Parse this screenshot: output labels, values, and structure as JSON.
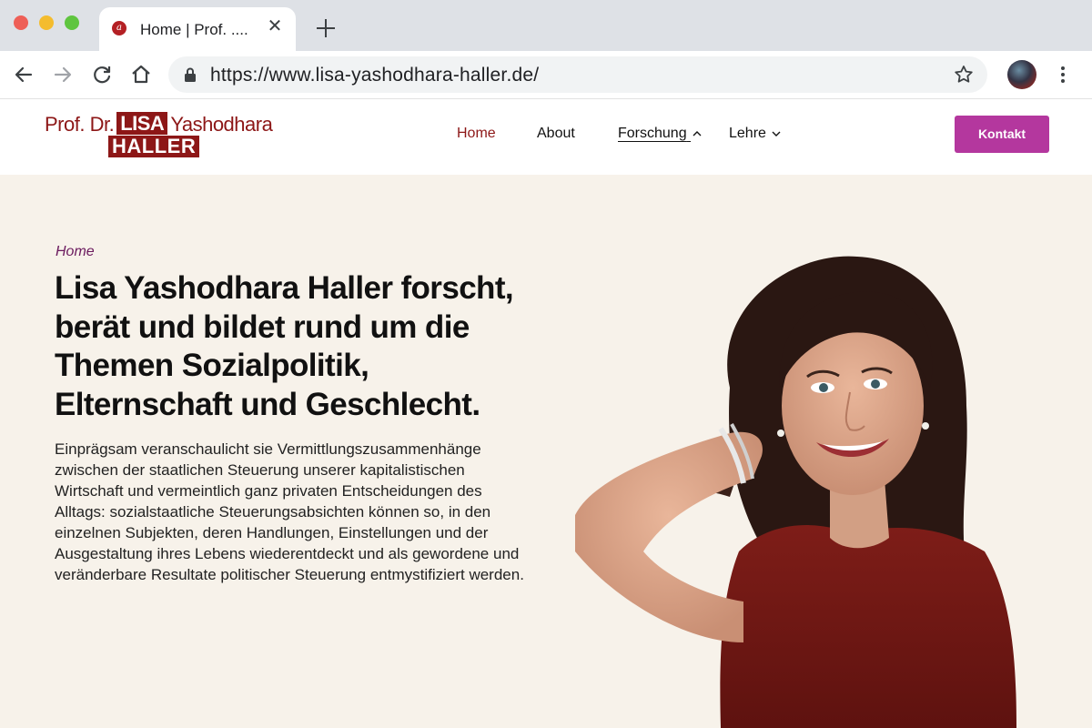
{
  "browser": {
    "tab_title": "Home | Prof. ....",
    "tab_favicon_glyph": "a",
    "url": "https://www.lisa-yashodhara-haller.de/"
  },
  "site": {
    "logo": {
      "prefix": "Prof. Dr.",
      "first_name": "LISA",
      "middle_name": "Yashodhara",
      "last_name": "HALLER"
    },
    "nav": {
      "home": "Home",
      "about": "About",
      "forschung": "Forschung",
      "lehre": "Lehre"
    },
    "cta": "Kontakt"
  },
  "hero": {
    "breadcrumb": "Home",
    "headline_name": "Lisa Yashodhara Haller",
    "headline_rest": " forscht, berät und bildet rund um die Themen Sozialpolitik, Elternschaft und Geschlecht.",
    "lead": "Einprägsam veranschaulicht sie Vermittlungszusammenhänge zwischen der staatlichen Steuerung unserer kapitalistischen Wirtschaft und vermeintlich ganz privaten Entscheidungen des Alltags: sozialstaatliche Steuerungsabsichten können so, in den einzelnen Subjekten, deren Handlungen, Einstellungen und der Ausgestaltung ihres Lebens wiederentdeckt und als gewordene und veränderbare Resultate politischer Steuerung entmystifiziert werden."
  },
  "colors": {
    "brand_red": "#8d1717",
    "cta_magenta": "#b4379e",
    "hero_background": "#f7f2ea",
    "breadcrumb_purple": "#6b1a5e"
  },
  "icons": [
    "back-icon",
    "forward-icon",
    "reload-icon",
    "home-icon",
    "lock-icon",
    "star-icon",
    "menu-icon",
    "close-icon",
    "plus-icon",
    "chevron-up-icon",
    "chevron-down-icon"
  ]
}
